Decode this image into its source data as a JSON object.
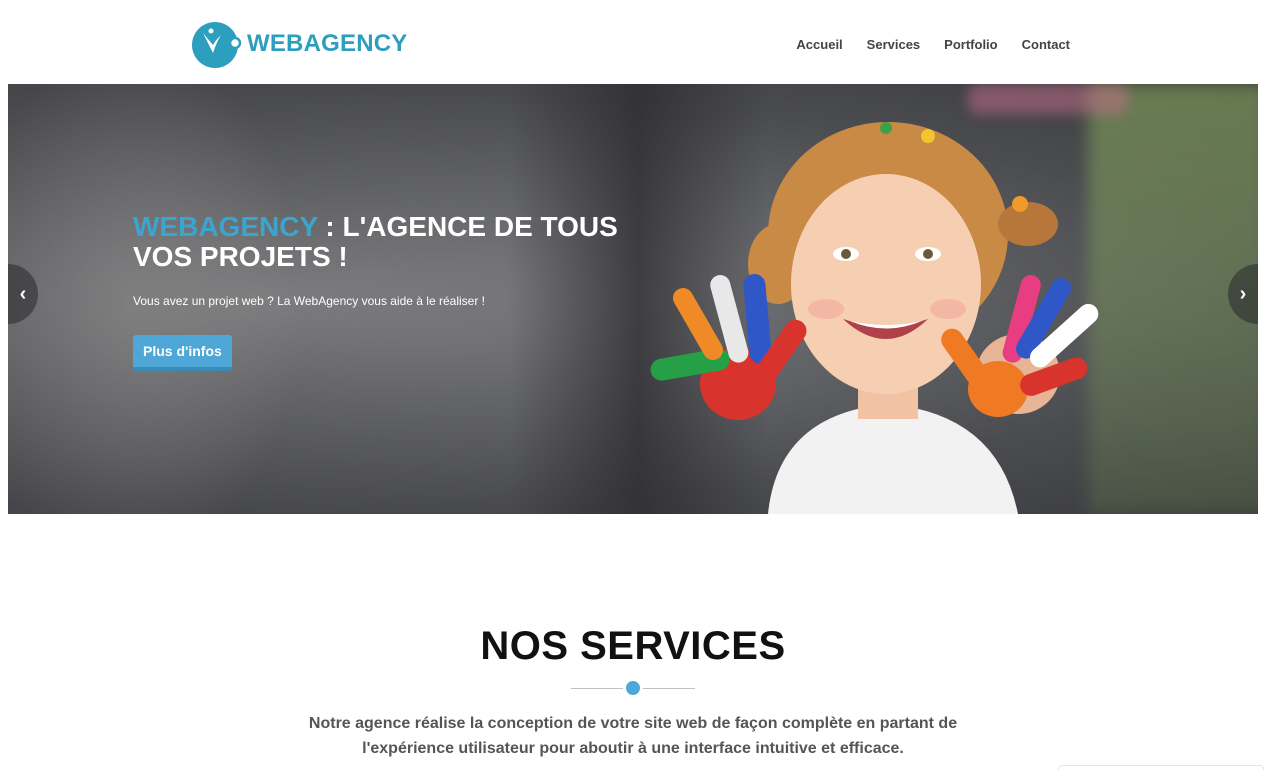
{
  "header": {
    "logo_text": "WEBAGENCY",
    "nav": [
      {
        "label": "Accueil"
      },
      {
        "label": "Services"
      },
      {
        "label": "Portfolio"
      },
      {
        "label": "Contact"
      }
    ]
  },
  "hero": {
    "title_brand": "WEBAGENCY",
    "title_rest": " : L'AGENCE DE TOUS VOS PROJETS !",
    "subtitle": "Vous avez un projet web ? La WebAgency vous aide à le réaliser !",
    "button_label": "Plus d'infos",
    "prev_icon": "chevron-left-icon",
    "next_icon": "chevron-right-icon"
  },
  "services": {
    "title": "NOS SERVICES",
    "description": "Notre agence réalise la conception de votre site web de façon complète en partant de l'expérience utilisateur pour aboutir à une interface intuitive et efficace."
  },
  "colors": {
    "accent": "#4ea7d6",
    "brand": "#2b9fbd",
    "title": "#111111"
  }
}
